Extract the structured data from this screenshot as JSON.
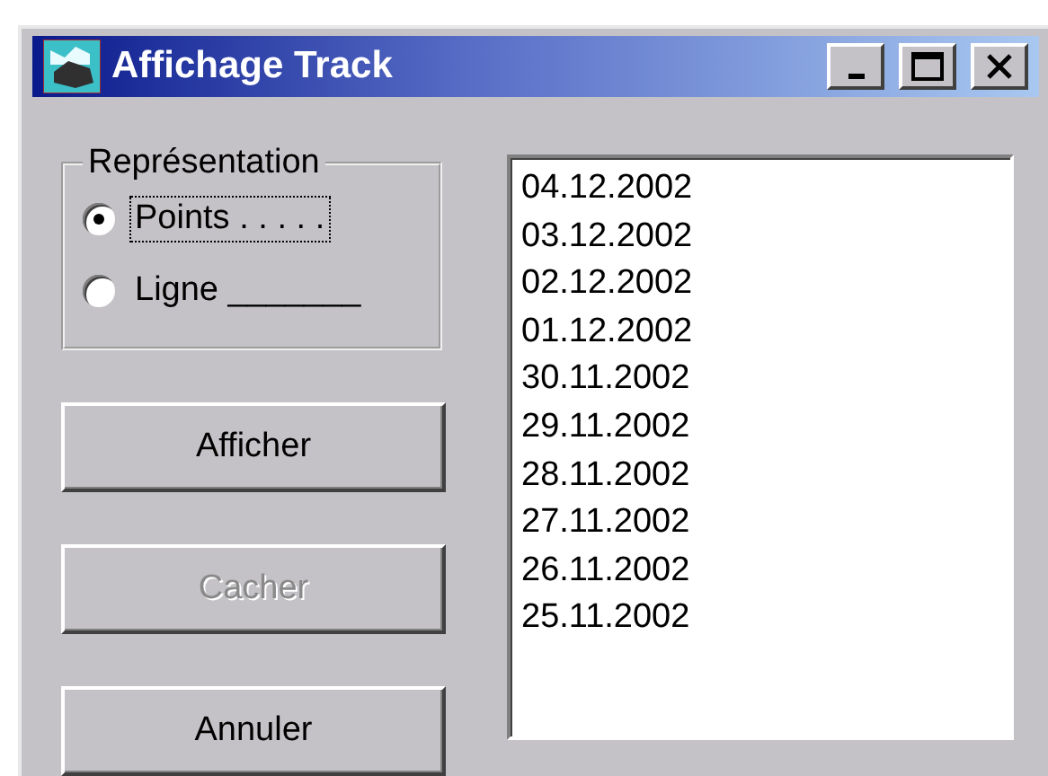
{
  "window": {
    "title": "Affichage Track"
  },
  "title_buttons": [
    {
      "kind": "minimize"
    },
    {
      "kind": "maximize"
    },
    {
      "kind": "close"
    }
  ],
  "group": {
    "title": "Représentation",
    "options": [
      {
        "label": "Points . . . . .",
        "selected": true
      },
      {
        "label": "Ligne _______",
        "selected": false
      }
    ]
  },
  "buttons": [
    {
      "label": "Afficher",
      "disabled": false
    },
    {
      "label": "Cacher",
      "disabled": true
    },
    {
      "label": "Annuler",
      "disabled": false
    }
  ],
  "list": [
    "04.12.2002",
    "03.12.2002",
    "02.12.2002",
    "01.12.2002",
    "30.11.2002",
    "29.11.2002",
    "28.11.2002",
    "27.11.2002",
    "26.11.2002",
    "25.11.2002"
  ]
}
